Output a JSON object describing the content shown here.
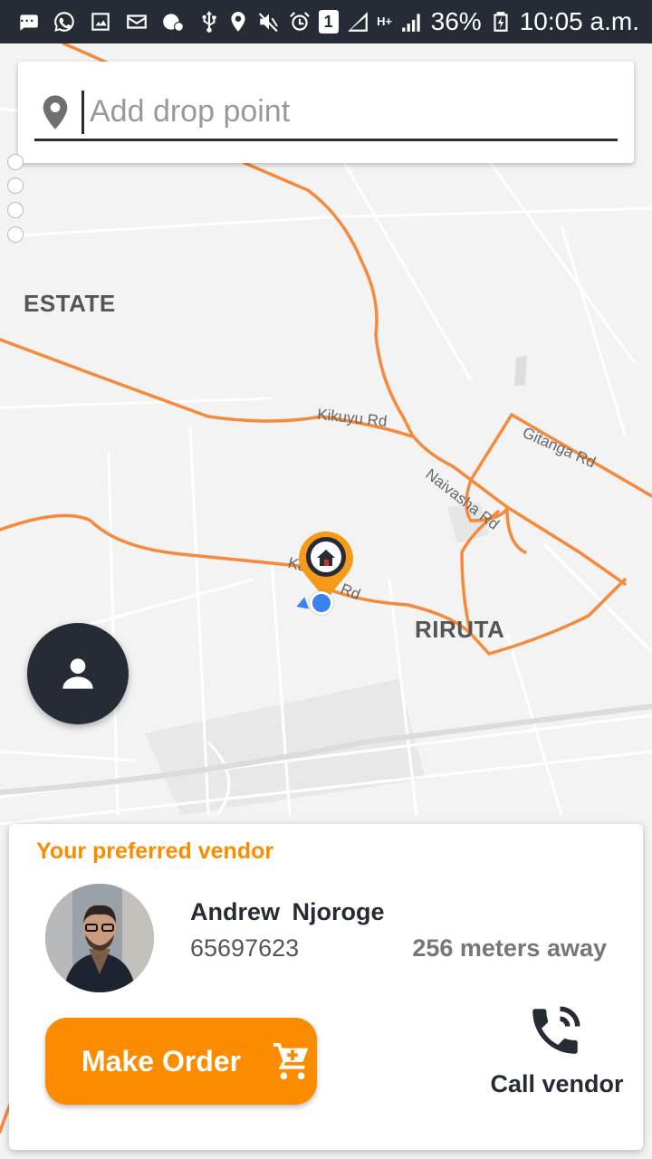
{
  "status_bar": {
    "icons": [
      "message-icon",
      "whatsapp-icon",
      "gallery-icon",
      "email-icon",
      "settings-alert-icon",
      "usb-icon",
      "location-icon",
      "mute-icon",
      "alarm-icon",
      "sim-1-icon",
      "signal-icon",
      "network-type-icon",
      "signal-icon",
      "battery-icon"
    ],
    "sim_label": "1",
    "network_type": "H+",
    "battery": "36%",
    "time": "10:05 a.m."
  },
  "search": {
    "placeholder": "Add drop point",
    "value": ""
  },
  "map": {
    "area_labels": [
      "ESTATE",
      "RIRUTA"
    ],
    "road_labels": [
      "Kikuyu Rd",
      "Naivasha Rd",
      "Gitanga Rd",
      "Ka",
      "Rd"
    ],
    "road_color": "#f58a3c"
  },
  "vendor": {
    "section_title": "Your preferred vendor",
    "name": "Andrew  Njoroge",
    "phone": "65697623",
    "distance": "256 meters away",
    "make_order_label": "Make Order",
    "call_label": "Call vendor"
  },
  "colors": {
    "accent": "#fb8c00",
    "dark": "#262b36",
    "location_blue": "#3b82f0"
  }
}
